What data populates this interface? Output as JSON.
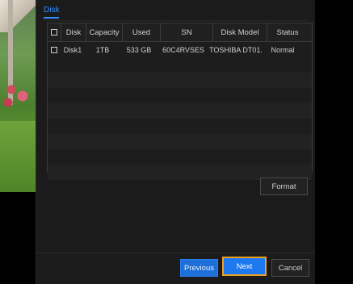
{
  "tab": {
    "label": "Disk"
  },
  "table": {
    "headers": [
      "Disk",
      "Capacity",
      "Used",
      "SN",
      "Disk Model",
      "Status"
    ],
    "rows": [
      {
        "disk": "Disk1",
        "capacity": "1TB",
        "used": "533 GB",
        "sn": "60C4RVSES",
        "model": "TOSHIBA DT01.",
        "status": "Normal"
      }
    ]
  },
  "buttons": {
    "format": "Format",
    "previous": "Previous",
    "next": "Next",
    "cancel": "Cancel"
  },
  "colors": {
    "accent": "#1e78f0",
    "focus": "#f0a020",
    "panel": "#1b1b1b"
  }
}
